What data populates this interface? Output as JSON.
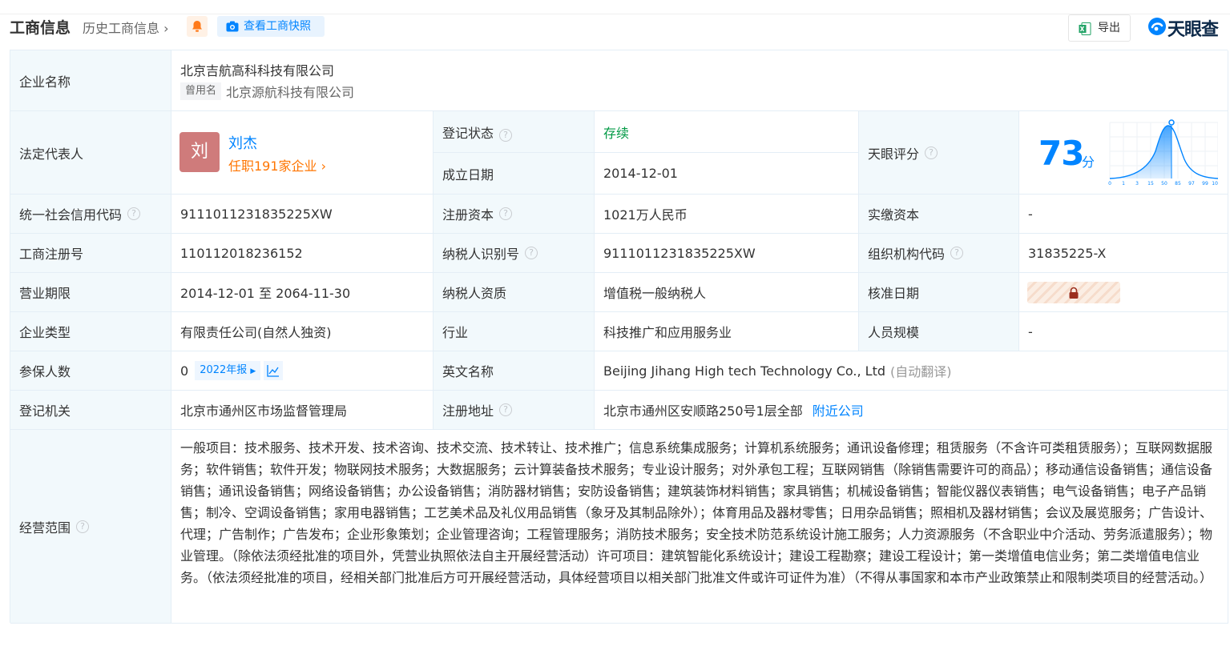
{
  "header": {
    "title": "工商信息",
    "history": "历史工商信息",
    "snapshot_button": "查看工商快照",
    "export_button": "导出",
    "brand": "天眼查"
  },
  "company": {
    "name_label": "企业名称",
    "name": "北京吉航高科科技有限公司",
    "former_tag": "曾用名",
    "former_name": "北京源航科技有限公司"
  },
  "legal_rep": {
    "label": "法定代表人",
    "avatar_char": "刘",
    "name": "刘杰",
    "positions": "任职191家企业"
  },
  "status": {
    "label": "登记状态",
    "value": "存续"
  },
  "founded": {
    "label": "成立日期",
    "value": "2014-12-01"
  },
  "tianyan": {
    "label": "天眼评分",
    "score": "73",
    "unit": "分",
    "ticks": [
      "0",
      "1",
      "3",
      "15",
      "50",
      "85",
      "97",
      "99",
      "100"
    ],
    "score_fraction": 0.73
  },
  "rows": [
    [
      {
        "label": "统一社会信用代码",
        "help": true,
        "value": "911101123183522​5XW"
      },
      {
        "label": "注册资本",
        "help": true,
        "value": "1021万人民币"
      },
      {
        "label": "实缴资本",
        "help": false,
        "value": "-"
      }
    ],
    [
      {
        "label": "工商注册号",
        "help": false,
        "value": "110112018236152"
      },
      {
        "label": "纳税人识别号",
        "help": true,
        "value": "911101123183522​5XW"
      },
      {
        "label": "组织机构代码",
        "help": true,
        "value": "31835225-X"
      }
    ],
    [
      {
        "label": "营业期限",
        "help": false,
        "value": "2014-12-01 至 2064-11-30"
      },
      {
        "label": "纳税人资质",
        "help": false,
        "value": "增值税一般纳税人"
      },
      {
        "label": "核准日期",
        "help": false,
        "value": ""
      }
    ],
    [
      {
        "label": "企业类型",
        "help": false,
        "value": "有限责任公司(自然人独资)"
      },
      {
        "label": "行业",
        "help": false,
        "value": "科技推广和应用服务业"
      },
      {
        "label": "人员规模",
        "help": false,
        "value": "-"
      }
    ]
  ],
  "insured": {
    "label": "参保人数",
    "value": "0",
    "year_tag": "2022年报"
  },
  "english": {
    "label": "英文名称",
    "value": "Beijing Jihang High tech Technology Co., Ltd",
    "translate": "(自动翻译)"
  },
  "authority": {
    "label": "登记机关",
    "value": "北京市通州区市场监督管理局"
  },
  "address": {
    "label": "注册地址",
    "value": "北京市通州区安顺路250号1层全部",
    "nearby": "附近公司"
  },
  "scope": {
    "label": "经营范围",
    "text": "一般项目：技术服务、技术开发、技术咨询、技术交流、技术转让、技术推广；信息系统集成服务；计算机系统服务；通讯设备修理；租赁服务（不含许可类租赁服务）；互联网数据服务；软件销售；软件开发；物联网技术服务；大数据服务；云计算装备技术服务；专业设计服务；对外承包工程；互联网销售（除销售需要许可的商品）；移动通信设备销售；通信设备销售；通讯设备销售；网络设备销售；办公设备销售；消防器材销售；安防设备销售；建筑装饰材料销售；家具销售；机械设备销售；智能仪器仪表销售；电气设备销售；电子产品销售；制冷、空调设备销售；家用电器销售；工艺美术品及礼仪用品销售（象牙及其制品除外）；体育用品及器材零售；日用杂品销售；照相机及器材销售；会议及展览服务；广告设计、代理；广告制作；广告发布；企业形象策划；企业管理咨询；工程管理服务；消防技术服务；安全技术防范系统设计施工服务；人力资源服务（不含职业中介活动、劳务派遣服务）；物业管理。（除依法须经批准的项目外，凭营业执照依法自主开展经营活动）许可项目：建筑智能化系统设计；建设工程勘察；建设工程设计；第一类增值电信业务；第二类增值电信业务。（依法须经批准的项目，经相关部门批准后方可开展经营活动，具体经营项目以相关部门批准文件或许可证件为准）（不得从事国家和本市产业政策禁止和限制类项目的经营活动。）"
  },
  "colors": {
    "accent": "#0084ff",
    "label_bg": "#f2f9fc",
    "status_green": "#009944",
    "orange": "#ff7500"
  }
}
